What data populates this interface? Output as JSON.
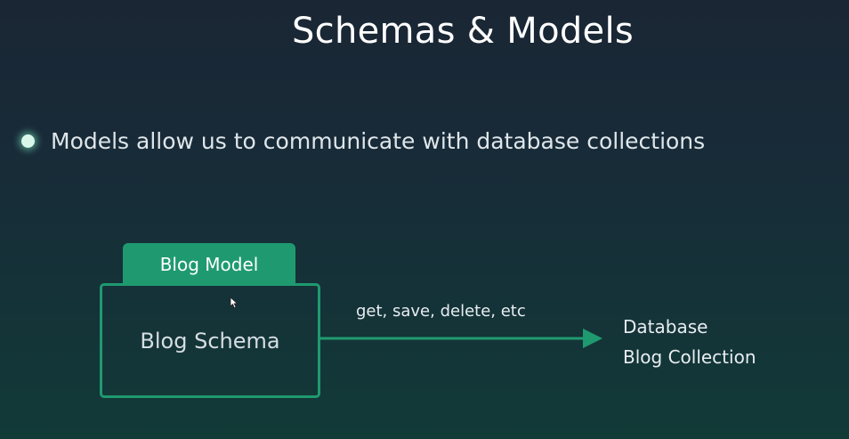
{
  "slide": {
    "title": "Schemas & Models",
    "bullet": "Models allow us to communicate with database collections"
  },
  "diagram": {
    "model_tab_label": "Blog Model",
    "schema_label": "Blog Schema",
    "arrow_label": "get, save, delete, etc",
    "target_line_1": "Database",
    "target_line_2": "Blog Collection"
  },
  "colors": {
    "accent_green": "#1f9a70",
    "bullet_glow": "#d8f7ea"
  },
  "icons": {
    "bullet": "glowing-dot-icon",
    "arrow": "arrow-right-icon",
    "cursor": "mouse-pointer-icon"
  }
}
